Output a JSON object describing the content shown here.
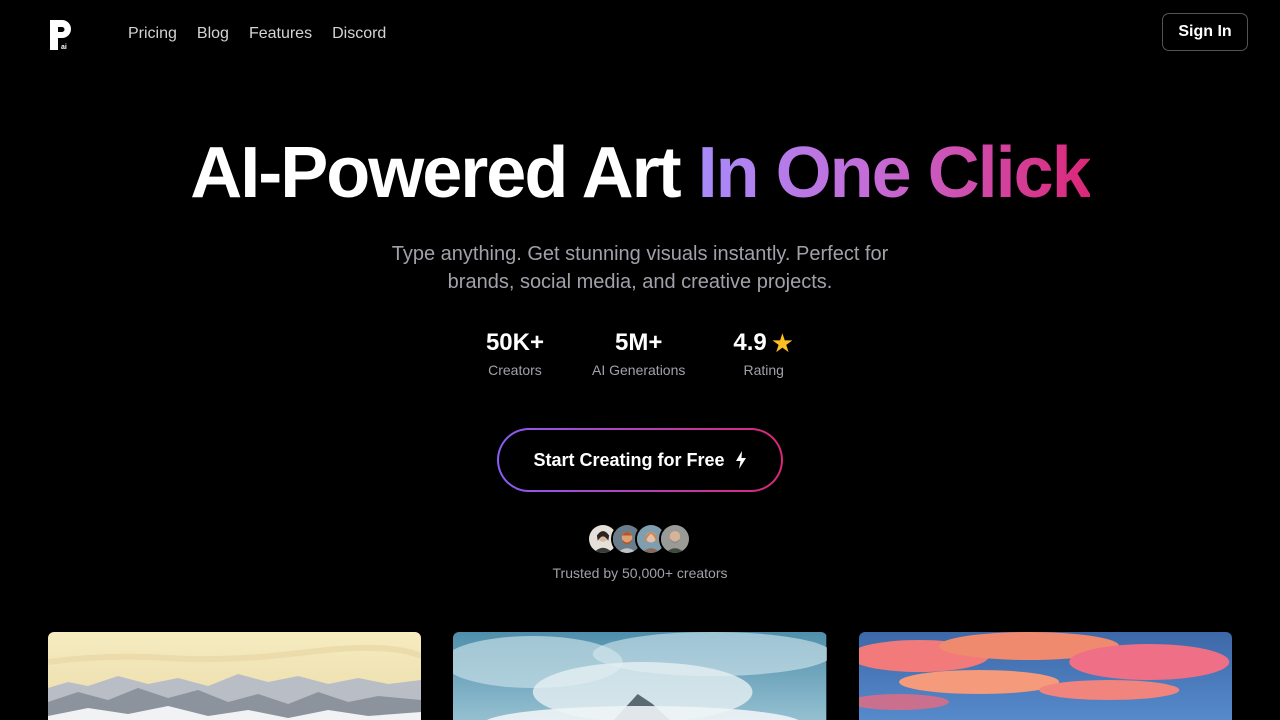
{
  "nav": {
    "links": [
      "Pricing",
      "Blog",
      "Features",
      "Discord"
    ],
    "sign_in": "Sign In"
  },
  "hero": {
    "headline_plain": "AI-Powered Art",
    "headline_accent": "In One Click",
    "subtitle": "Type anything. Get stunning visuals instantly. Perfect for brands, social media, and creative projects."
  },
  "stats": [
    {
      "value": "50K+",
      "label": "Creators"
    },
    {
      "value": "5M+",
      "label": "AI Generations"
    },
    {
      "value": "4.9",
      "label": "Rating",
      "icon": "star-icon"
    }
  ],
  "cta": {
    "label": "Start Creating for Free",
    "icon": "lightning-icon"
  },
  "social_proof": {
    "avatar_count": 4,
    "text": "Trusted by 50,000+ creators"
  },
  "gallery": {
    "cards": [
      "mountain-landscape",
      "cloudy-peak",
      "sunset-clouds"
    ]
  },
  "colors": {
    "background": "#000000",
    "accent_start": "#a78bfa",
    "accent_end": "#db2777",
    "star": "#fbbf24",
    "muted_text": "#a1a1aa"
  }
}
